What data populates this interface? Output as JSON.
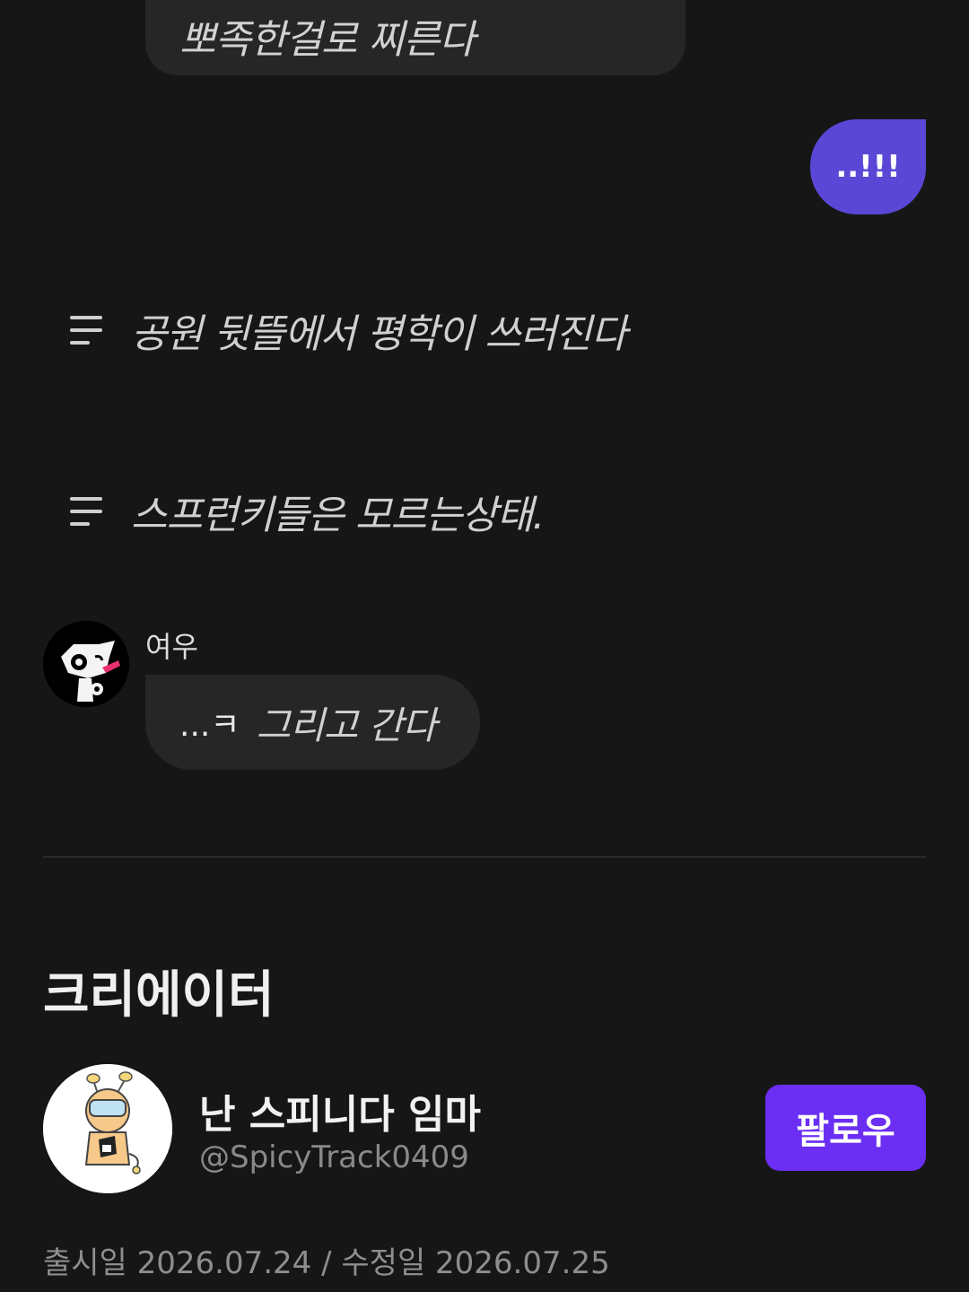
{
  "messages": {
    "top_bubble": "뽀족한걸로 찌른다",
    "my_bubble": "..!!!",
    "narration_1": "공원 뒷뜰에서 평학이 쓰러진다",
    "narration_2": "스프런키들은 모르는상태.",
    "fox_sender": "여우",
    "fox_plain": "...ㅋ",
    "fox_italic": "그리고 간다"
  },
  "creator_section": {
    "title": "크리에이터",
    "name": "난 스피니다 임마",
    "handle": "@SpicyTrack0409",
    "follow_label": "팔로우",
    "dates": "출시일 2026.07.24 / 수정일 2026.07.25"
  },
  "colors": {
    "background": "#161617",
    "bubble": "#262627",
    "my_bubble": "#5b47d6",
    "follow_button": "#6a2ff2"
  },
  "icons": {
    "narration": "text-lines-icon"
  }
}
